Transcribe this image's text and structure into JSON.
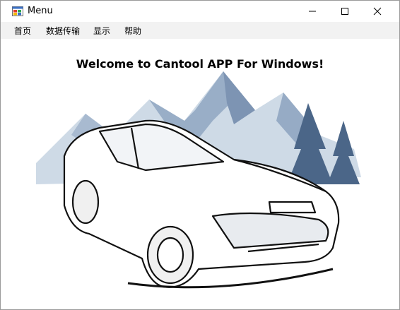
{
  "window": {
    "title": "Menu"
  },
  "menu": {
    "items": [
      "首页",
      "数据传输",
      "显示",
      "帮助"
    ]
  },
  "main": {
    "welcome": "Welcome to Cantool APP For Windows!"
  },
  "icons": {
    "app": "windows-forms-app-icon",
    "minimize": "minimize-icon",
    "maximize": "maximize-icon",
    "close": "close-icon",
    "illustration": "car-sketch-mountains-illustration"
  }
}
